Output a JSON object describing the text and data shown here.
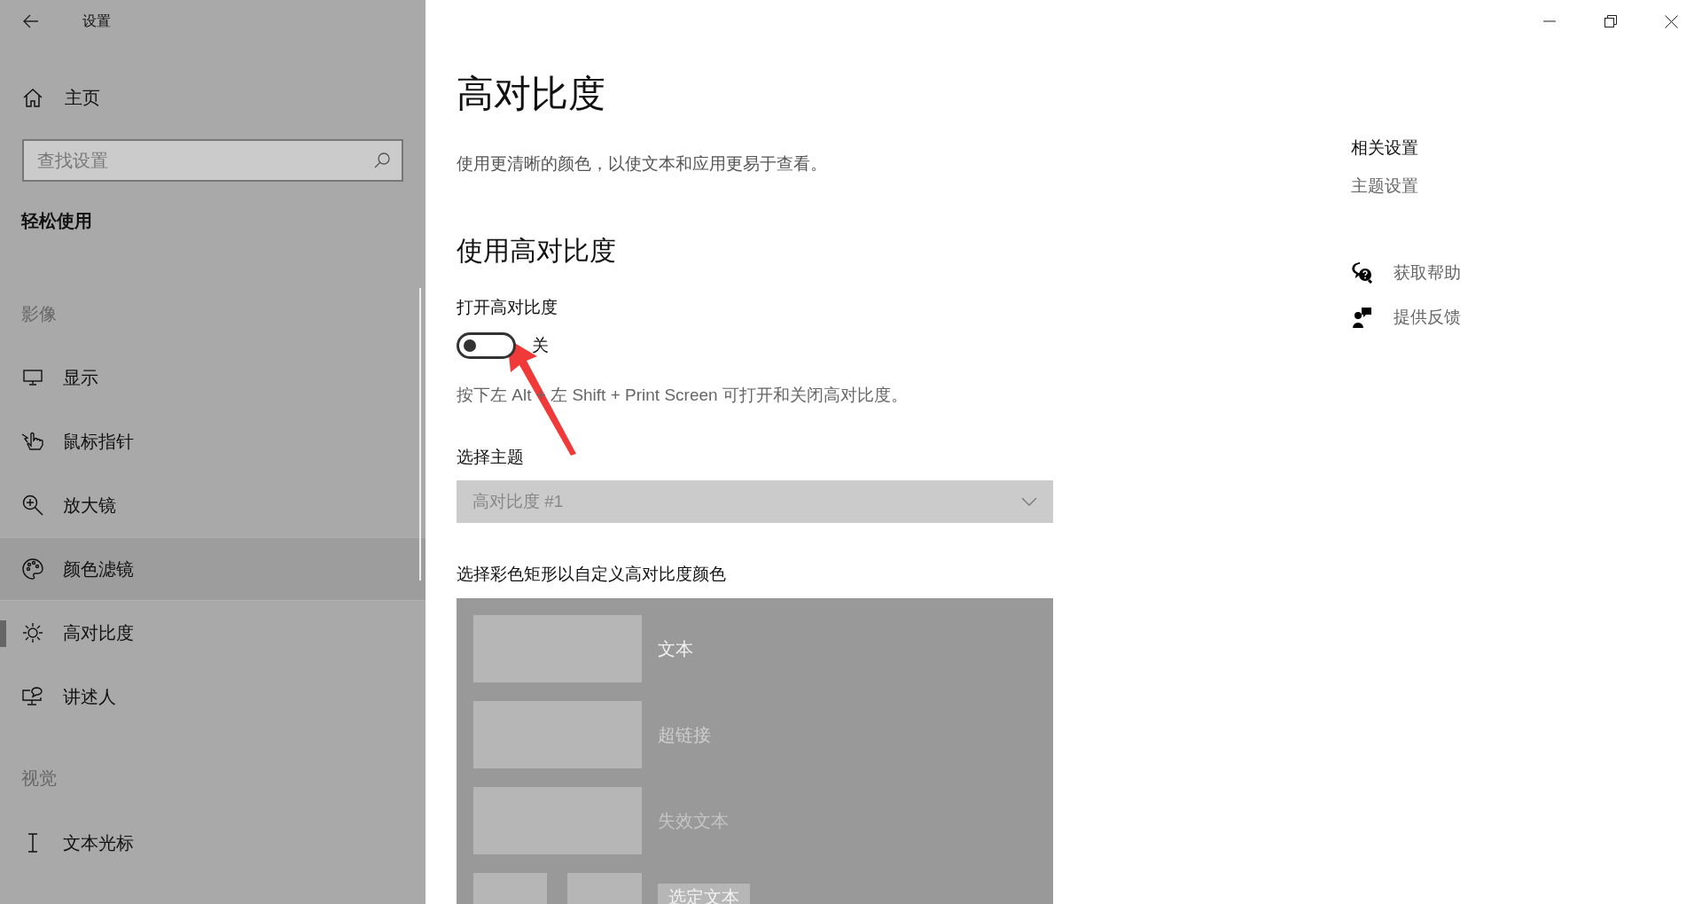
{
  "window": {
    "title": "设置"
  },
  "sidebar": {
    "home": "主页",
    "search": {
      "placeholder": "查找设置"
    },
    "category": "轻松使用",
    "groups": [
      {
        "heading": "影像",
        "items": [
          {
            "label": "显示",
            "selected": false,
            "hovered": false
          },
          {
            "label": "鼠标指针",
            "selected": false,
            "hovered": false
          },
          {
            "label": "放大镜",
            "selected": false,
            "hovered": false
          },
          {
            "label": "颜色滤镜",
            "selected": false,
            "hovered": true
          },
          {
            "label": "高对比度",
            "selected": true,
            "hovered": false
          },
          {
            "label": "讲述人",
            "selected": false,
            "hovered": false
          }
        ]
      },
      {
        "heading": "视觉",
        "items": [
          {
            "label": "文本光标",
            "selected": false,
            "hovered": false
          }
        ]
      }
    ]
  },
  "main": {
    "title": "高对比度",
    "description": "使用更清晰的颜色，以使文本和应用更易于查看。",
    "section": "使用高对比度",
    "toggle": {
      "label": "打开高对比度",
      "on": false,
      "state_text": "关"
    },
    "shortcut_hint": "按下左 Alt + 左 Shift + Print Screen 可打开和关闭高对比度。",
    "theme": {
      "label": "选择主题",
      "value": "高对比度 #1"
    },
    "colors": {
      "label": "选择彩色矩形以自定义高对比度颜色",
      "rows": [
        {
          "kind": "text",
          "label": "文本"
        },
        {
          "kind": "hyperlink",
          "label": "超链接"
        },
        {
          "kind": "disabled",
          "label": "失效文本"
        },
        {
          "kind": "selected",
          "label": "选定文本"
        }
      ]
    }
  },
  "related": {
    "heading": "相关设置",
    "links": [
      "主题设置"
    ]
  },
  "help": [
    {
      "label": "获取帮助"
    },
    {
      "label": "提供反馈"
    }
  ]
}
